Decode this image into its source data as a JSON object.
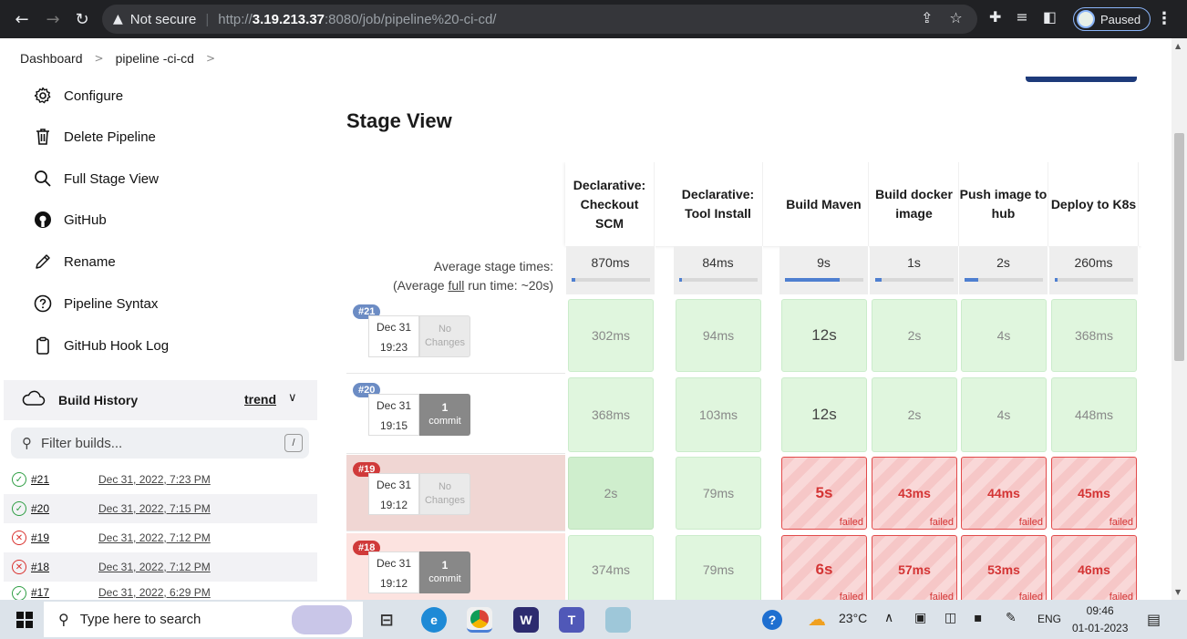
{
  "browser": {
    "not_secure": "Not secure",
    "url_scheme": "http://",
    "url_host": "3.19.213.37",
    "url_path": ":8080/job/pipeline%20-ci-cd/",
    "profile_status": "Paused"
  },
  "breadcrumb": {
    "dashboard": "Dashboard",
    "job": "pipeline -ci-cd"
  },
  "sidebar": {
    "tasks": [
      {
        "label": "Configure",
        "icon": "gear-icon"
      },
      {
        "label": "Delete Pipeline",
        "icon": "trash-icon"
      },
      {
        "label": "Full Stage View",
        "icon": "search-icon"
      },
      {
        "label": "GitHub",
        "icon": "github-icon"
      },
      {
        "label": "Rename",
        "icon": "pencil-icon"
      },
      {
        "label": "Pipeline Syntax",
        "icon": "help-icon"
      },
      {
        "label": "GitHub Hook Log",
        "icon": "clipboard-icon"
      }
    ],
    "build_history": {
      "title": "Build History",
      "trend": "trend",
      "filter_placeholder": "Filter builds...",
      "filter_shortcut": "/",
      "builds": [
        {
          "num": "#21",
          "date": "Dec 31, 2022, 7:23 PM",
          "status": "success"
        },
        {
          "num": "#20",
          "date": "Dec 31, 2022, 7:15 PM",
          "status": "success"
        },
        {
          "num": "#19",
          "date": "Dec 31, 2022, 7:12 PM",
          "status": "failed"
        },
        {
          "num": "#18",
          "date": "Dec 31, 2022, 7:12 PM",
          "status": "failed"
        },
        {
          "num": "#17",
          "date": "Dec 31, 2022, 6:29 PM",
          "status": "success"
        }
      ]
    }
  },
  "stage_view": {
    "title": "Stage View",
    "avg_label_1": "Average stage times:",
    "avg_label_2_pre": "(Average ",
    "avg_label_2_link": "full",
    "avg_label_2_post": " run time: ~20s)",
    "stages": [
      {
        "name": "Declarative: Checkout SCM",
        "avg": "870ms",
        "bar": 0.05
      },
      {
        "name": "Declarative: Tool Install",
        "avg": "84ms",
        "bar": 0.02
      },
      {
        "name": "Build Maven",
        "avg": "9s",
        "bar": 0.7
      },
      {
        "name": "Build docker image",
        "avg": "1s",
        "bar": 0.08
      },
      {
        "name": "Push image to hub",
        "avg": "2s",
        "bar": 0.18
      },
      {
        "name": "Deploy to K8s",
        "avg": "260ms",
        "bar": 0.03
      }
    ],
    "runs": [
      {
        "badge": "#21",
        "date": "Dec 31",
        "time": "19:23",
        "changes": "No Changes",
        "commit_count": "",
        "commit_label": "",
        "status": "success",
        "cells": [
          {
            "t": "302ms",
            "s": "ok"
          },
          {
            "t": "94ms",
            "s": "ok"
          },
          {
            "t": "12s",
            "s": "ok-big"
          },
          {
            "t": "2s",
            "s": "ok"
          },
          {
            "t": "4s",
            "s": "ok"
          },
          {
            "t": "368ms",
            "s": "ok"
          }
        ]
      },
      {
        "badge": "#20",
        "date": "Dec 31",
        "time": "19:15",
        "changes": "",
        "commit_count": "1",
        "commit_label": "commit",
        "status": "success",
        "cells": [
          {
            "t": "368ms",
            "s": "ok"
          },
          {
            "t": "103ms",
            "s": "ok"
          },
          {
            "t": "12s",
            "s": "ok-big"
          },
          {
            "t": "2s",
            "s": "ok"
          },
          {
            "t": "4s",
            "s": "ok"
          },
          {
            "t": "448ms",
            "s": "ok"
          }
        ]
      },
      {
        "badge": "#19",
        "date": "Dec 31",
        "time": "19:12",
        "changes": "No Changes",
        "commit_count": "",
        "commit_label": "",
        "status": "failed",
        "cells": [
          {
            "t": "2s",
            "s": "ok-dark"
          },
          {
            "t": "79ms",
            "s": "ok"
          },
          {
            "t": "5s",
            "s": "fail-big"
          },
          {
            "t": "43ms",
            "s": "fail"
          },
          {
            "t": "44ms",
            "s": "fail"
          },
          {
            "t": "45ms",
            "s": "fail"
          }
        ]
      },
      {
        "badge": "#18",
        "date": "Dec 31",
        "time": "19:12",
        "changes": "",
        "commit_count": "1",
        "commit_label": "commit",
        "status": "failed",
        "cells": [
          {
            "t": "374ms",
            "s": "ok"
          },
          {
            "t": "79ms",
            "s": "ok"
          },
          {
            "t": "6s",
            "s": "fail-big"
          },
          {
            "t": "57ms",
            "s": "fail"
          },
          {
            "t": "53ms",
            "s": "fail"
          },
          {
            "t": "46ms",
            "s": "fail"
          }
        ]
      }
    ],
    "failed_label": "failed"
  },
  "taskbar": {
    "search_placeholder": "Type here to search",
    "weather": "23°C",
    "lang": "ENG",
    "time": "09:46",
    "date": "01-01-2023"
  },
  "colors": {
    "success": "#2f9e44",
    "failure": "#d9302d",
    "stage_ok": "#e0f6de",
    "stage_fail": "#f6c7c7",
    "accent": "#4e7fd0"
  }
}
